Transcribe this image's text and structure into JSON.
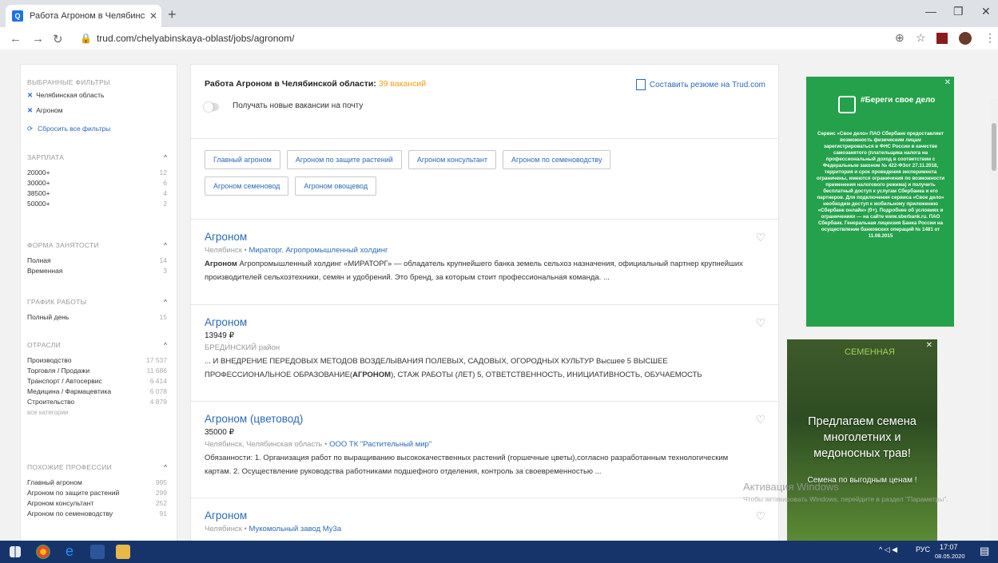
{
  "browser": {
    "tab_title": "Работа Агроном в Челябинско",
    "url": "trud.com/chelyabinskaya-oblast/jobs/agronom/"
  },
  "filters": {
    "selected_heading": "ВЫБРАННЫЕ ФИЛЬТРЫ",
    "selected": [
      "Челябинская область",
      "Агроном"
    ],
    "reset": "Сбросить все фильтры",
    "salary": {
      "heading": "ЗАРПЛАТА",
      "rows": [
        {
          "label": "20000+",
          "count": "12"
        },
        {
          "label": "30000+",
          "count": "6"
        },
        {
          "label": "38500+",
          "count": "4"
        },
        {
          "label": "50000+",
          "count": "2"
        }
      ]
    },
    "employment": {
      "heading": "ФОРМА ЗАНЯТОСТИ",
      "rows": [
        {
          "label": "Полная",
          "count": "14"
        },
        {
          "label": "Временная",
          "count": "3"
        }
      ]
    },
    "schedule": {
      "heading": "ГРАФИК РАБОТЫ",
      "rows": [
        {
          "label": "Полный день",
          "count": "15"
        }
      ]
    },
    "industry": {
      "heading": "ОТРАСЛИ",
      "rows": [
        {
          "label": "Производство",
          "count": "17 537"
        },
        {
          "label": "Торговля / Продажи",
          "count": "11 686"
        },
        {
          "label": "Транспорт / Автосервис",
          "count": "6 414"
        },
        {
          "label": "Медицина / Фармацевтика",
          "count": "6 078"
        },
        {
          "label": "Строительство",
          "count": "4 879"
        }
      ],
      "more": "все категории"
    },
    "similar": {
      "heading": "ПОХОЖИЕ ПРОФЕССИИ",
      "rows": [
        {
          "label": "Главный агроном",
          "count": "995"
        },
        {
          "label": "Агроном по защите растений",
          "count": "299"
        },
        {
          "label": "Агроном консультант",
          "count": "252"
        },
        {
          "label": "Агроном по семеноводству",
          "count": "91"
        }
      ]
    }
  },
  "header": {
    "title_prefix": "Работа Агроном в Челябинской области:",
    "count": "39 вакансий",
    "subscribe": "Получать новые вакансии на почту",
    "resume_link": "Составить резюме на Trud.com"
  },
  "tags": [
    "Главный агроном",
    "Агроном по защите растений",
    "Агроном консультант",
    "Агроном по семеноводству",
    "Агроном семеновод",
    "Агроном овощевод"
  ],
  "jobs": [
    {
      "title": "Агроном",
      "salary": "",
      "location": "Челябинск",
      "company": "Мираторг. Агропромышленный холдинг",
      "desc_bold": "Агроном",
      "desc": " Агропромышленный холдинг «МИРАТОРГ» — обладатель крупнейшего банка земель сельхоз назначения, официальный партнер крупнейших производителей сельхозтехники, семян и удобрений. Это бренд, за которым стоит профессиональная команда. ..."
    },
    {
      "title": "Агроном",
      "salary": "13949 ₽",
      "location": "БРЕДИНСКИЙ район",
      "company": "",
      "desc_pre": "... И ВНЕДРЕНИЕ ПЕРЕДОВЫХ МЕТОДОВ ВОЗДЕЛЫВАНИЯ ПОЛЕВЫХ, САДОВЫХ, ОГОРОДНЫХ КУЛЬТУР Высшее 5 ВЫСШЕЕ ПРОФЕССИОНАЛЬНОЕ ОБРАЗОВАНИЕ(",
      "desc_bold": "АГРОНОМ",
      "desc": "), СТАЖ РАБОТЫ (ЛЕТ) 5, ОТВЕТСТВЕННОСТЬ, ИНИЦИАТИВНОСТЬ, ОБУЧАЕМОСТЬ"
    },
    {
      "title": "Агроном (цветовод)",
      "salary": "35000 ₽",
      "location": "Челябинск, Челябинская область",
      "company": "ООО ТК \"Растительный мир\"",
      "desc": "Обязанности: 1. Организация работ по выращиванию высококачественных растений (горшечные цветы),согласно разработанным технологическим картам. 2. Осуществление руководства работниками подшефного отделения, контроль за своевременностью ..."
    },
    {
      "title": "Агроном",
      "salary": "",
      "location": "Челябинск",
      "company": "Мукомольный завод Му3а",
      "desc": ""
    }
  ],
  "ad1": {
    "brand": "#Береги свое дело",
    "text": "Сервис «Свое дело» ПАО Сбербанк предоставляет возможность физическим лицам зарегистрироваться в ФНС России в качестве самозанятого (плательщика налога на профессиональный доход в соответствии с Федеральным законом № 422-ФЗот 27.11.2018, территория и срок проведения эксперимента ограничены, имеются ограничения по возможности применения налогового режима) и получить бесплатный доступ к услугам Сбербанка и его партнеров. Для подключения сервиса «Свое дело» необходим доступ к мобильному приложению «Сбербанк онлайн» (0+). Подробнее об условиях и ограничениях — на сайте www.sberbank.ru. ПАО Сбербанк. Генеральная лицензия Банка России на осуществление банковских операций № 1481 от 11.08.2015"
  },
  "ad2": {
    "logo": "СЕМЕННАЯ",
    "headline": "Предлагаем семена многолетних и медоносных трав!",
    "sub": "Семена по выгодным ценам !"
  },
  "watermark": {
    "title": "Активация Windows",
    "text": "Чтобы активировать Windows, перейдите в раздел \"Параметры\"."
  },
  "taskbar": {
    "lang": "РУС",
    "time": "17:07",
    "date": "08.05.2020"
  }
}
